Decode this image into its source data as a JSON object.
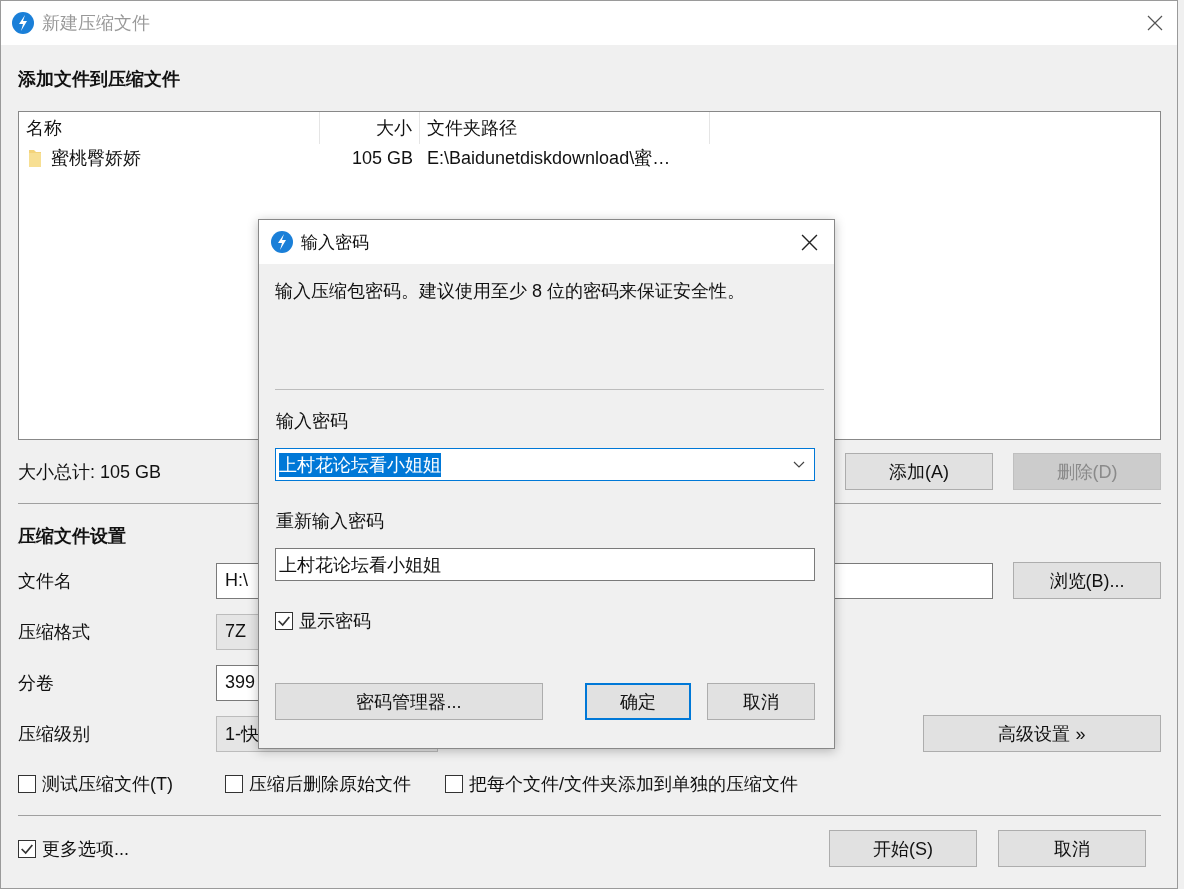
{
  "window": {
    "title": "新建压缩文件"
  },
  "files_section": {
    "heading": "添加文件到压缩文件",
    "columns": [
      "名称",
      "大小",
      "文件夹路径"
    ],
    "rows": [
      {
        "kind": "folder",
        "name": "蜜桃臀娇娇",
        "size": "105 GB",
        "path": "E:\\Baidunetdiskdownload\\蜜…"
      }
    ],
    "total": "大小总计: 105 GB",
    "buttons": [
      {
        "label": "添加(A)",
        "disabled": false
      },
      {
        "label": "删除(D)",
        "disabled": true
      }
    ]
  },
  "settings": {
    "heading": "压缩文件设置",
    "fields": [
      {
        "label": "文件名",
        "kind": "text",
        "value": "H:\\"
      },
      {
        "label": "压缩格式",
        "kind": "combo",
        "value": "7Z"
      },
      {
        "label": "分卷",
        "kind": "text",
        "value": "399"
      },
      {
        "label": "压缩级别",
        "kind": "combo",
        "value": "1-快"
      }
    ],
    "browse_button": "浏览(B)...",
    "advanced_button": "高级设置 »",
    "options": [
      {
        "label": "测试压缩文件(T)",
        "checked": false
      },
      {
        "label": "压缩后删除原始文件",
        "checked": false
      },
      {
        "label": "把每个文件/文件夹添加到单独的压缩文件",
        "checked": false
      }
    ]
  },
  "footer": {
    "more_options": {
      "label": "更多选项...",
      "checked": true
    },
    "buttons": [
      "开始(S)",
      "取消"
    ]
  },
  "dialog": {
    "title": "输入密码",
    "message": "输入压缩包密码。建议使用至少 8 位的密码来保证安全性。",
    "password_label": "输入密码",
    "password": "上村花论坛看小姐姐",
    "password_selected": true,
    "confirm_label": "重新输入密码",
    "confirm": "上村花论坛看小姐姐",
    "show_password": {
      "label": "显示密码",
      "checked": true
    },
    "buttons": [
      {
        "label": "密码管理器...",
        "default": false
      },
      {
        "label": "确定",
        "default": true
      },
      {
        "label": "取消",
        "default": false
      }
    ]
  }
}
